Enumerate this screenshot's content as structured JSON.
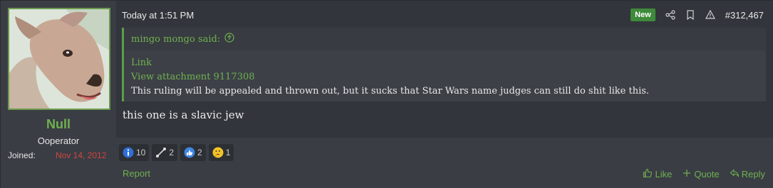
{
  "user": {
    "name": "Null",
    "title": "Ooperator",
    "joined_label": "Joined:",
    "joined_value": "Nov 14, 2012"
  },
  "post": {
    "timestamp": "Today at 1:51 PM",
    "badge": "New",
    "number": "#312,467",
    "message": "this one is a slavic jew"
  },
  "quote": {
    "author": "mingo mongo said:",
    "link1": "Link",
    "link2": "View attachment 9117308",
    "text": "This ruling will be appealed and thrown out, but it sucks that Star Wars name judges can still do shit like this."
  },
  "reactions": [
    {
      "icon": "informative-icon",
      "count": "10"
    },
    {
      "icon": "autistic-icon",
      "count": "2"
    },
    {
      "icon": "thumbs-up-icon",
      "count": "2"
    },
    {
      "icon": "thinking-icon",
      "count": "1"
    }
  ],
  "footer": {
    "report": "Report",
    "like": "Like",
    "quote": "Quote",
    "reply": "Reply"
  },
  "colors": {
    "accent_green": "#6fb14f",
    "joined_red": "#d0453f",
    "new_badge": "#3e8a3a"
  }
}
